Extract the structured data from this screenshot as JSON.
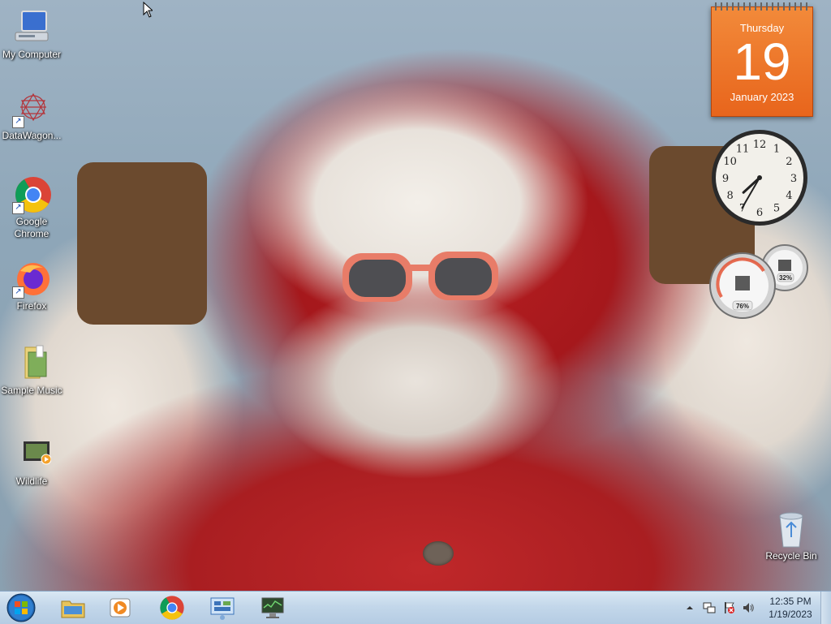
{
  "desktop": {
    "icons": [
      {
        "label": "My Computer",
        "icon": "computer-icon"
      },
      {
        "label": "DataWagon...",
        "icon": "datawagon-icon"
      },
      {
        "label": "Google Chrome",
        "icon": "chrome-icon"
      },
      {
        "label": "Firefox",
        "icon": "firefox-icon"
      },
      {
        "label": "Sample Music",
        "icon": "music-folder-icon"
      },
      {
        "label": "Wildlife",
        "icon": "video-file-icon"
      },
      {
        "label": "Recycle Bin",
        "icon": "recycle-bin-icon"
      }
    ]
  },
  "gadgets": {
    "calendar": {
      "weekday": "Thursday",
      "day": "19",
      "month_year": "January 2023"
    },
    "clock": {
      "hour": 7,
      "minute": 35,
      "numerals": [
        "12",
        "1",
        "2",
        "3",
        "4",
        "5",
        "6",
        "7",
        "8",
        "9",
        "10",
        "11"
      ]
    },
    "cpu_meter": {
      "cpu": "76%",
      "memory": "32%"
    }
  },
  "taskbar": {
    "start_icon": "windows-start-icon",
    "apps": [
      {
        "name": "File Explorer",
        "icon": "folder-icon"
      },
      {
        "name": "Windows Media Player",
        "icon": "media-player-icon"
      },
      {
        "name": "Google Chrome",
        "icon": "chrome-icon"
      },
      {
        "name": "Control Panel",
        "icon": "control-panel-icon"
      },
      {
        "name": "Monitor",
        "icon": "monitor-icon"
      }
    ],
    "tray": {
      "time": "12:35 PM",
      "date": "1/19/2023"
    }
  },
  "colors": {
    "calendar_orange": "#e8651c",
    "taskbar": "#c3d7ea"
  }
}
